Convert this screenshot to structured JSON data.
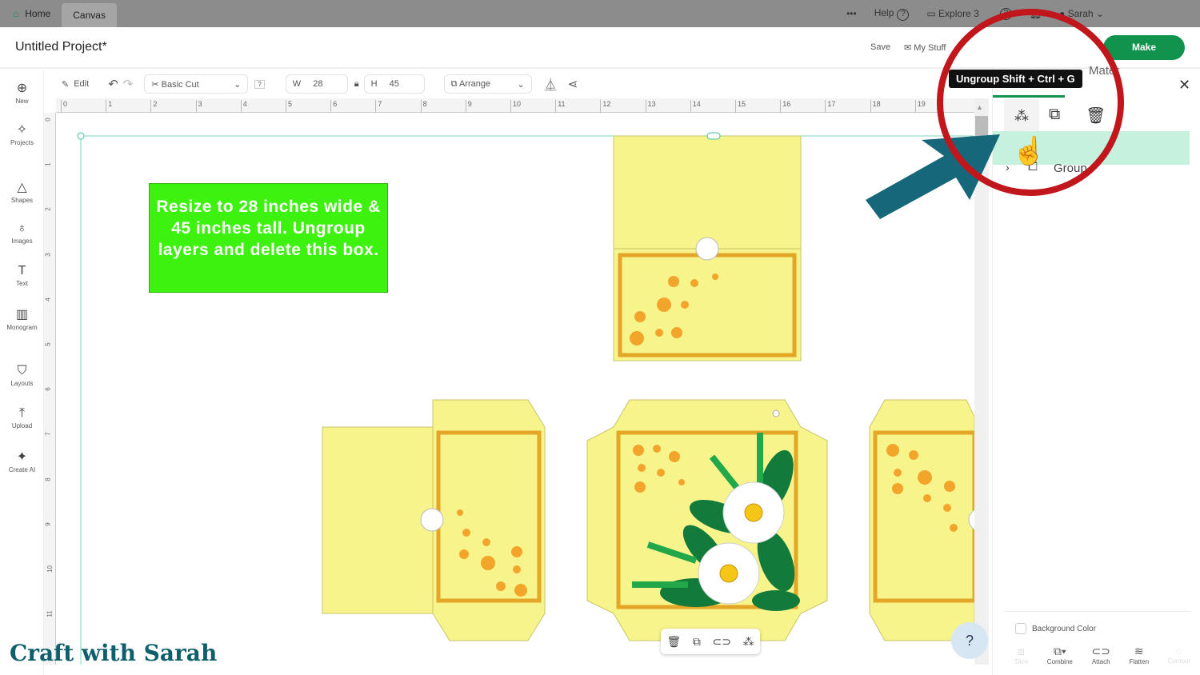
{
  "topbar": {
    "tabs": [
      {
        "label": "Home"
      },
      {
        "label": "Canvas"
      }
    ],
    "more": "•••",
    "help": "Help",
    "machine": "Explore 3",
    "user": "Sarah"
  },
  "header": {
    "title": "Untitled Project*",
    "save": "Save",
    "my_stuff": "My Stuff",
    "make": "Make"
  },
  "toolbar": {
    "edit": "Edit",
    "operation": "Basic Cut",
    "help_box": "?",
    "w_label": "W",
    "w_value": "28",
    "h_label": "H",
    "h_value": "45",
    "arrange": "Arrange"
  },
  "sidebar": {
    "items": [
      {
        "label": "New"
      },
      {
        "label": "Projects"
      },
      {
        "label": "Shapes"
      },
      {
        "label": "Images"
      },
      {
        "label": "Text"
      },
      {
        "label": "Monogram"
      },
      {
        "label": "Layouts"
      },
      {
        "label": "Upload"
      },
      {
        "label": "Create AI"
      }
    ]
  },
  "ruler": {
    "h": [
      "0",
      "1",
      "2",
      "3",
      "4",
      "5",
      "6",
      "7",
      "8",
      "9",
      "10",
      "11",
      "12",
      "13",
      "14",
      "15",
      "16",
      "17",
      "18",
      "19"
    ],
    "v": [
      "0",
      "1",
      "2",
      "3",
      "4",
      "5",
      "6",
      "7",
      "8",
      "9",
      "10",
      "11"
    ]
  },
  "note": "Resize to 28 inches wide & 45 inches tall. Ungroup layers and delete this box.",
  "panel": {
    "tooltip": "Ungroup Shift + Ctrl + G",
    "layer_name": "Group",
    "tab_partial": "Mater",
    "bg_color": "Background Color",
    "tools": [
      {
        "label": "Slice"
      },
      {
        "label": "Combine"
      },
      {
        "label": "Attach"
      },
      {
        "label": "Flatten"
      },
      {
        "label": "Contour"
      }
    ]
  },
  "watermark": "Craft with Sarah",
  "colors": {
    "accent": "#12934d",
    "paper": "#f7f48c",
    "border": "#e3a626",
    "highlight": "#c5f1de",
    "circle": "#c1161b",
    "arrow": "#17677a"
  }
}
